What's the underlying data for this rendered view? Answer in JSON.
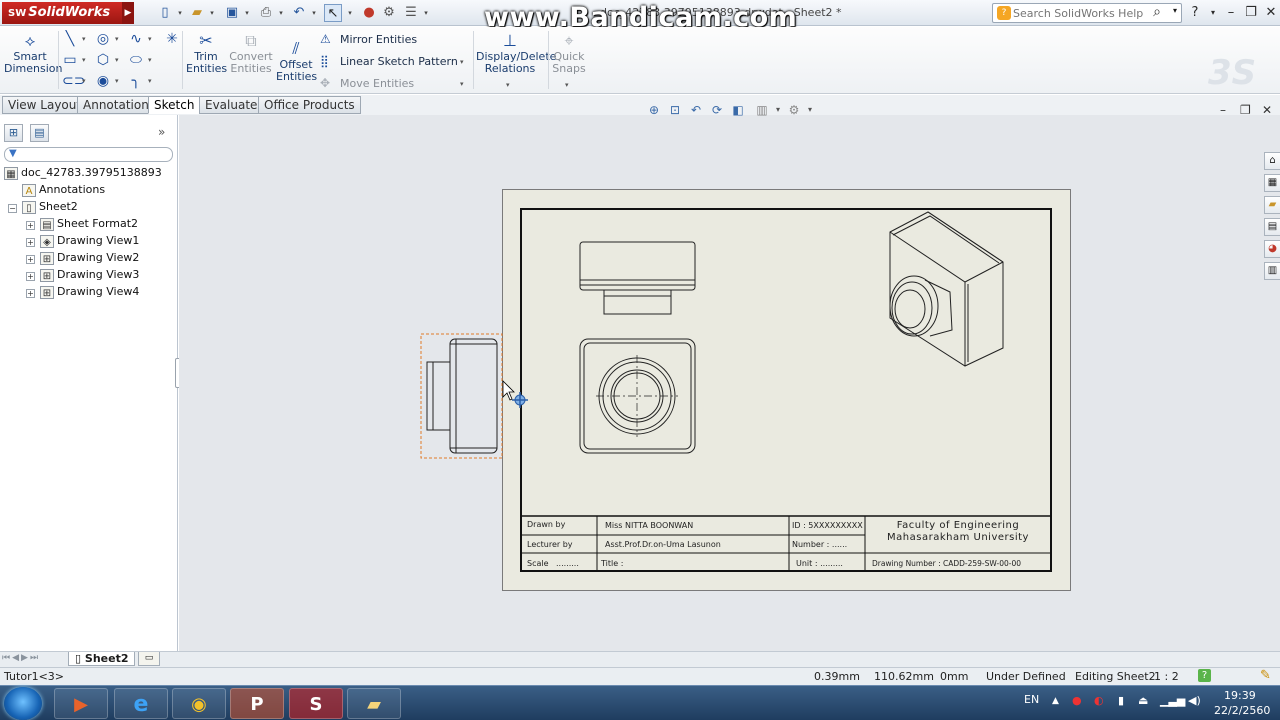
{
  "app": {
    "name": "SolidWorks",
    "logo_prefix": "SW"
  },
  "window": {
    "title_fragment": "doc_42783.39795138893.drwdot - Sheet2 *",
    "watermark": "www.Bandicam.com"
  },
  "search": {
    "placeholder": "Search SolidWorks Help"
  },
  "commands": {
    "smart_dimension": "Smart Dimension",
    "trim_entities": "Trim Entities",
    "convert_entities": "Convert Entities",
    "offset_entities": "Offset Entities",
    "mirror_entities": "Mirror Entities",
    "linear_sketch_pattern": "Linear Sketch Pattern",
    "move_entities": "Move Entities",
    "display_delete_relations": "Display/Delete Relations",
    "quick_snaps": "Quick Snaps"
  },
  "tabs": [
    {
      "label": "View Layout"
    },
    {
      "label": "Annotation"
    },
    {
      "label": "Sketch",
      "active": true
    },
    {
      "label": "Evaluate"
    },
    {
      "label": "Office Products"
    }
  ],
  "tree": {
    "root": "doc_42783.39795138893",
    "annotations": "Annotations",
    "sheet": "Sheet2",
    "children": [
      "Sheet Format2",
      "Drawing View1",
      "Drawing View2",
      "Drawing View3",
      "Drawing View4"
    ]
  },
  "title_block": {
    "drawn_by_label": "Drawn by",
    "drawn_by_value": "Miss NITTA BOONWAN",
    "lecturer_label": "Lecturer by",
    "lecturer_value": "Asst.Prof.Dr.on-Uma Lasunon",
    "scale_label": "Scale",
    "scale_value": ".........",
    "title_label": "Title :",
    "id_label": "ID : 5XXXXXXXXX",
    "number_label": "Number : ......",
    "unit_label": "Unit : .........",
    "faculty_line1": "Faculty of Engineering",
    "faculty_line2": "Mahasarakham University",
    "drawing_number": "Drawing Number : CADD-259-SW-00-00"
  },
  "sheet_tabs": {
    "active": "Sheet2"
  },
  "status": {
    "left": "Tutor1<3>",
    "x": "0.39mm",
    "y": "110.62mm",
    "z": "0mm",
    "state": "Under Defined",
    "editing": "Editing Sheet2",
    "scale": "1 : 2"
  },
  "taskbar": {
    "lang": "EN",
    "time": "19:39",
    "date": "22/2/2560"
  }
}
